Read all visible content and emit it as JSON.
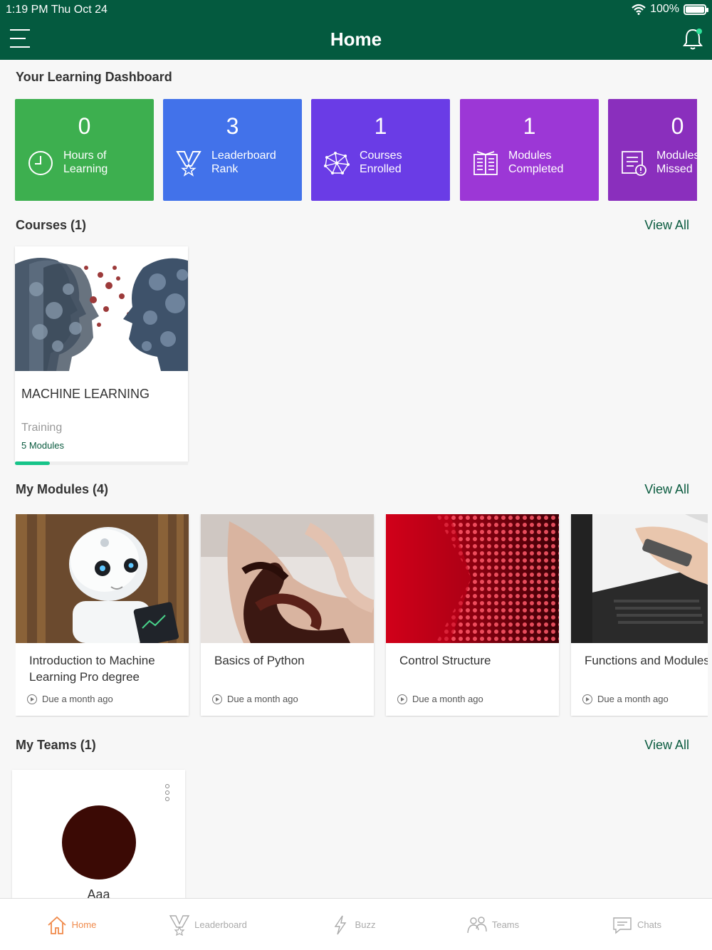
{
  "status_bar": {
    "time": "1:19 PM   Thu Oct 24",
    "battery": "100%"
  },
  "header": {
    "title": "Home"
  },
  "dashboard": {
    "title": "Your Learning Dashboard",
    "stats": [
      {
        "value": "0",
        "label1": "Hours of",
        "label2": "Learning",
        "color": "#3daf4f",
        "icon": "clock-icon"
      },
      {
        "value": "3",
        "label1": "Leaderboard",
        "label2": "Rank",
        "color": "#4272ea",
        "icon": "medal-icon"
      },
      {
        "value": "1",
        "label1": "Courses",
        "label2": "Enrolled",
        "color": "#6a3ce6",
        "icon": "network-icon"
      },
      {
        "value": "1",
        "label1": "Modules",
        "label2": "Completed",
        "color": "#9c37d6",
        "icon": "book-icon"
      },
      {
        "value": "0",
        "label1": "Modules",
        "label2": "Missed",
        "color": "#8a2fbd",
        "icon": "alert-doc-icon"
      }
    ]
  },
  "courses": {
    "title": "Courses (1)",
    "view_all": "View All",
    "items": [
      {
        "name": "MACHINE LEARNING",
        "type": "Training",
        "modules": "5 Modules",
        "progress": 0.2
      }
    ]
  },
  "my_modules": {
    "title": "My Modules (4)",
    "view_all": "View All",
    "items": [
      {
        "title": "Introduction to Machine Learning Pro degree",
        "due": "Due a month ago"
      },
      {
        "title": "Basics of Python",
        "due": "Due a month ago"
      },
      {
        "title": "Control Structure",
        "due": "Due a month ago"
      },
      {
        "title": "Functions and Modules",
        "due": "Due a month ago"
      }
    ]
  },
  "my_teams": {
    "title": "My Teams (1)",
    "view_all": "View All",
    "items": [
      {
        "name": "Aaa",
        "avatar_color": "#3b0a05"
      }
    ]
  },
  "tabbar": {
    "active": "Home",
    "tabs": [
      {
        "label": "Home",
        "icon": "home-icon"
      },
      {
        "label": "Leaderboard",
        "icon": "medal-icon"
      },
      {
        "label": "Buzz",
        "icon": "bolt-icon"
      },
      {
        "label": "Teams",
        "icon": "people-icon"
      },
      {
        "label": "Chats",
        "icon": "chat-icon"
      }
    ]
  }
}
